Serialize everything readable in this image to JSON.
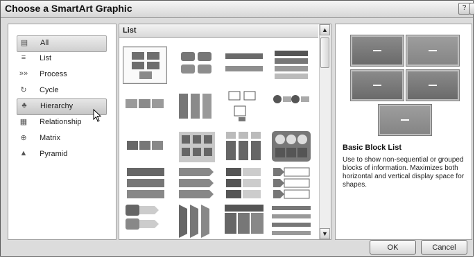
{
  "window": {
    "title": "Choose a SmartArt Graphic",
    "help_glyph": "?",
    "close_glyph": "✕"
  },
  "categories": [
    {
      "label": "All",
      "icon": "all-icon",
      "glyph": "▤"
    },
    {
      "label": "List",
      "icon": "list-icon",
      "glyph": "≡"
    },
    {
      "label": "Process",
      "icon": "process-icon",
      "glyph": "»»"
    },
    {
      "label": "Cycle",
      "icon": "cycle-icon",
      "glyph": "↻"
    },
    {
      "label": "Hierarchy",
      "icon": "hierarchy-icon",
      "glyph": "♣"
    },
    {
      "label": "Relationship",
      "icon": "relationship-icon",
      "glyph": "▦"
    },
    {
      "label": "Matrix",
      "icon": "matrix-icon",
      "glyph": "⊕"
    },
    {
      "label": "Pyramid",
      "icon": "pyramid-icon",
      "glyph": "▲"
    }
  ],
  "gallery": {
    "header": "List",
    "scroll_up": "▲",
    "scroll_down": "▼"
  },
  "preview": {
    "title": "Basic Block List",
    "description": "Use to show non-sequential or grouped blocks of information. Maximizes both horizontal and vertical display space for shapes."
  },
  "buttons": {
    "ok": "OK",
    "cancel": "Cancel"
  }
}
